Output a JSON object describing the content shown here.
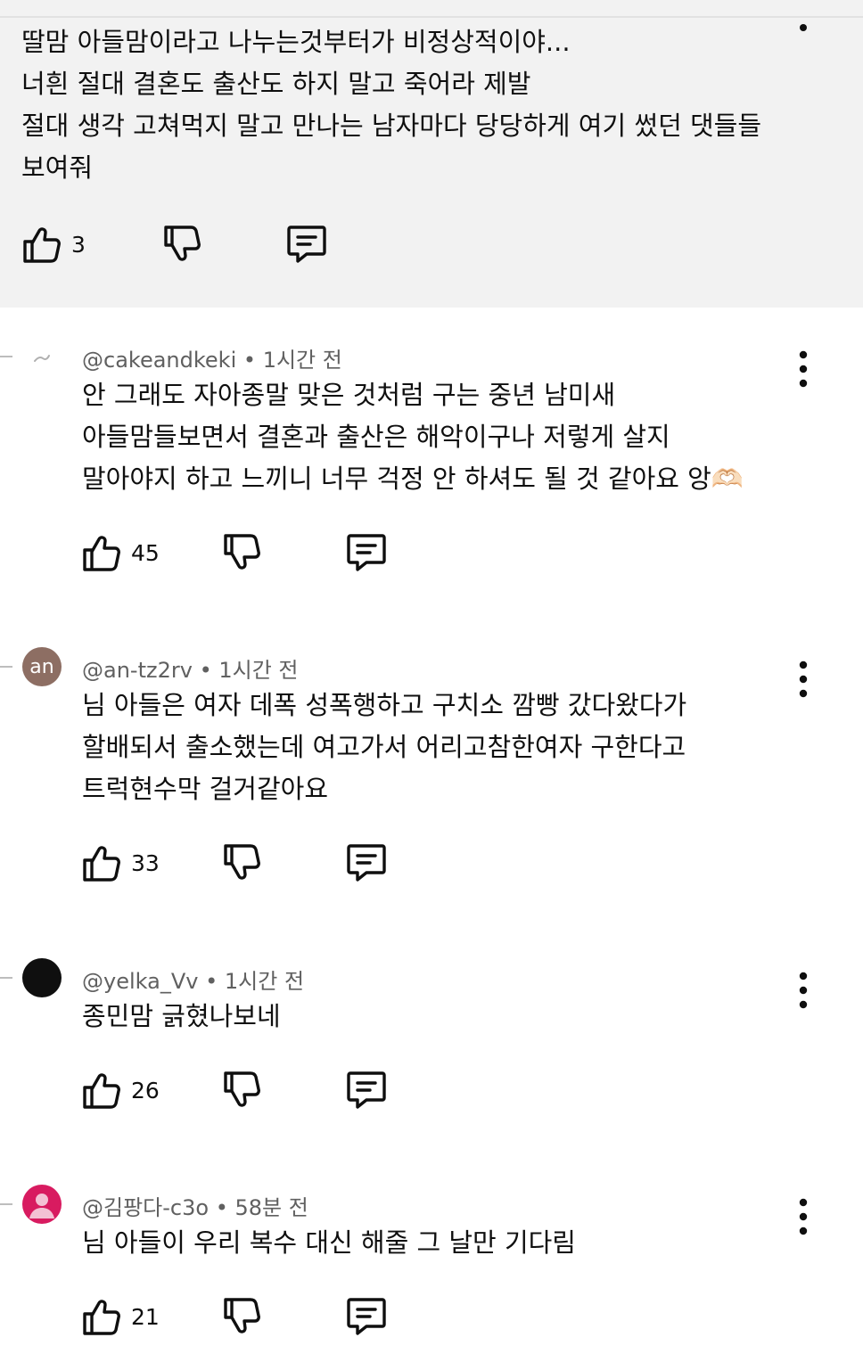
{
  "highlighted_comment": {
    "lines": [
      "딸맘 아들맘이라고 나누는것부터가 비정상적이야...",
      "너흰 절대 결혼도 출산도 하지 말고 죽어라 제발",
      "절대 생각 고쳐먹지 말고 만나는 남자마다 당당하게 여기 썼던 댓들들",
      "보여줘"
    ],
    "likes": "3"
  },
  "comments": [
    {
      "handle": "@cakeandkeki",
      "time": "1시간 전",
      "avatar_text": "",
      "lines": [
        "안 그래도 자아종말 맞은 것처럼 구는 중년 남미새",
        "아들맘들보면서 결혼과 출산은 해악이구나 저렇게 살지",
        "말아야지 하고 느끼니 너무 걱정 안 하셔도 될 것 같아요 앙🫶🏻"
      ],
      "likes": "45"
    },
    {
      "handle": "@an-tz2rv",
      "time": "1시간 전",
      "avatar_text": "an",
      "lines": [
        "님 아들은 여자 데폭 성폭행하고 구치소 깜빵 갔다왔다가",
        "할배되서 출소했는데 여고가서 어리고참한여자 구한다고",
        "트럭현수막 걸거같아요"
      ],
      "likes": "33"
    },
    {
      "handle": "@yelka_Vv",
      "time": "1시간 전",
      "avatar_text": "",
      "lines": [
        "종민맘 긁혔나보네"
      ],
      "likes": "26"
    },
    {
      "handle": "@김팡다-c3o",
      "time": "58분 전",
      "avatar_text": "",
      "lines": [
        "님 아들이 우리 복수 대신 해줄 그 날만 기다림"
      ],
      "likes": "21"
    }
  ],
  "meta_separator": "•",
  "icons": {
    "like": "thumbs-up-icon",
    "dislike": "thumbs-down-icon",
    "reply": "reply-comment-icon",
    "menu": "more-vertical-icon"
  },
  "colors": {
    "highlight_bg": "#f2f2f2",
    "meta_text": "#606060",
    "avatar_an": "#8d6e63",
    "avatar_yelka": "#0f0f0f",
    "avatar_kim": "#d81b60"
  }
}
